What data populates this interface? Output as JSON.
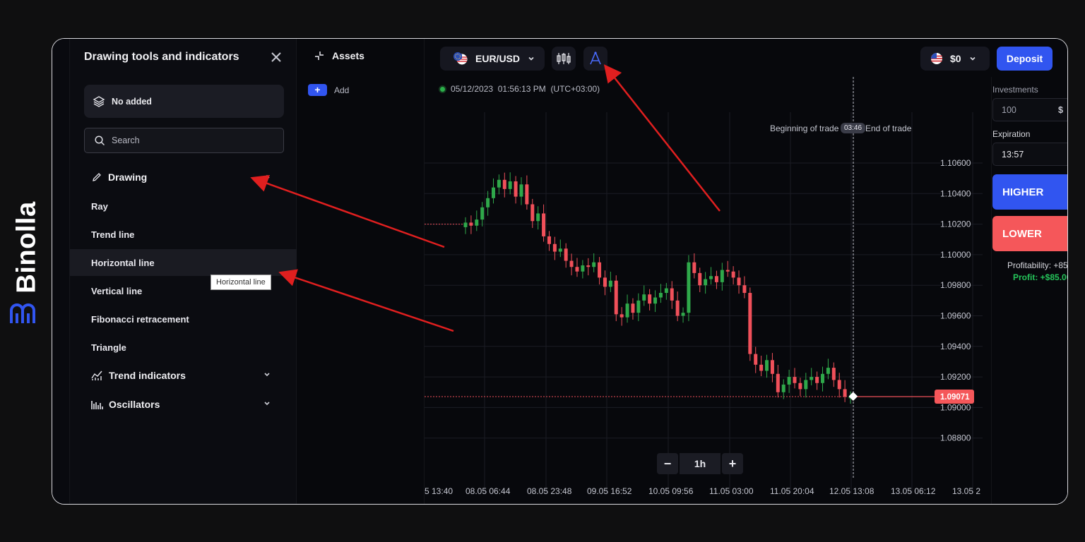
{
  "brand": {
    "name": "Binolla"
  },
  "panel": {
    "title": "Drawing tools and indicators",
    "no_added": "No added",
    "search_placeholder": "Search",
    "sections": {
      "drawing": "Drawing",
      "trend_indicators": "Trend indicators",
      "oscillators": "Oscillators"
    },
    "tools": [
      "Ray",
      "Trend line",
      "Horizontal line",
      "Vertical line",
      "Fibonacci retracement",
      "Triangle"
    ],
    "active_tool": "Horizontal line",
    "tooltip": "Horizontal line"
  },
  "assets": {
    "title": "Assets",
    "add_label": "Add"
  },
  "header": {
    "pair": "EUR/USD",
    "balance": "$0",
    "deposit": "Deposit"
  },
  "chart": {
    "timestamp": "05/12/2023  01:56:13 PM  (UTC+03:00)",
    "trade_begin": "Beginning of trade",
    "trade_timer": "03:46",
    "trade_end": "End of trade",
    "current_price": "1.09071",
    "timeframe": "1h",
    "zoom_minus": "−",
    "zoom_plus": "+",
    "y_ticks": [
      "1.10600",
      "1.10400",
      "1.10200",
      "1.10000",
      "1.09800",
      "1.09600",
      "1.09400",
      "1.09200",
      "1.09000",
      "1.08800"
    ],
    "x_ticks": [
      "5 13:40",
      "08.05 06:44",
      "08.05 23:48",
      "09.05 16:52",
      "10.05 09:56",
      "11.05 03:00",
      "11.05 20:04",
      "12.05 13:08",
      "13.05 06:12",
      "13.05 2"
    ],
    "colors": {
      "up": "#2fa84a",
      "down": "#f0505a",
      "grid": "#1b1c24",
      "price_tag": "#f5575a"
    }
  },
  "chart_data": {
    "type": "candlestick",
    "symbol": "EUR/USD",
    "timeframe": "1h",
    "ylim": [
      1.0875,
      1.1075
    ],
    "closes": [
      1.1021,
      1.1019,
      1.1023,
      1.1031,
      1.1037,
      1.1044,
      1.1049,
      1.1043,
      1.1048,
      1.1038,
      1.1046,
      1.1033,
      1.1022,
      1.1027,
      1.1012,
      1.1007,
      1.1002,
      1.1004,
      1.0996,
      1.0992,
      1.0989,
      1.0993,
      1.0992,
      1.0995,
      1.0985,
      1.0979,
      1.0983,
      1.0961,
      1.0959,
      1.0968,
      1.0962,
      1.097,
      1.0974,
      1.0968,
      1.0972,
      1.0975,
      1.0978,
      1.097,
      1.096,
      1.0962,
      1.0995,
      1.0988,
      1.098,
      1.0984,
      1.0986,
      1.0982,
      1.099,
      1.0989,
      1.0985,
      1.098,
      1.0975,
      1.0935,
      1.0928,
      1.0924,
      1.0931,
      1.0922,
      1.091,
      1.0915,
      1.092,
      1.0916,
      1.0912,
      1.0918,
      1.092,
      1.0916,
      1.0922,
      1.0926,
      1.0918,
      1.0912,
      1.0907,
      1.0907
    ]
  }
}
